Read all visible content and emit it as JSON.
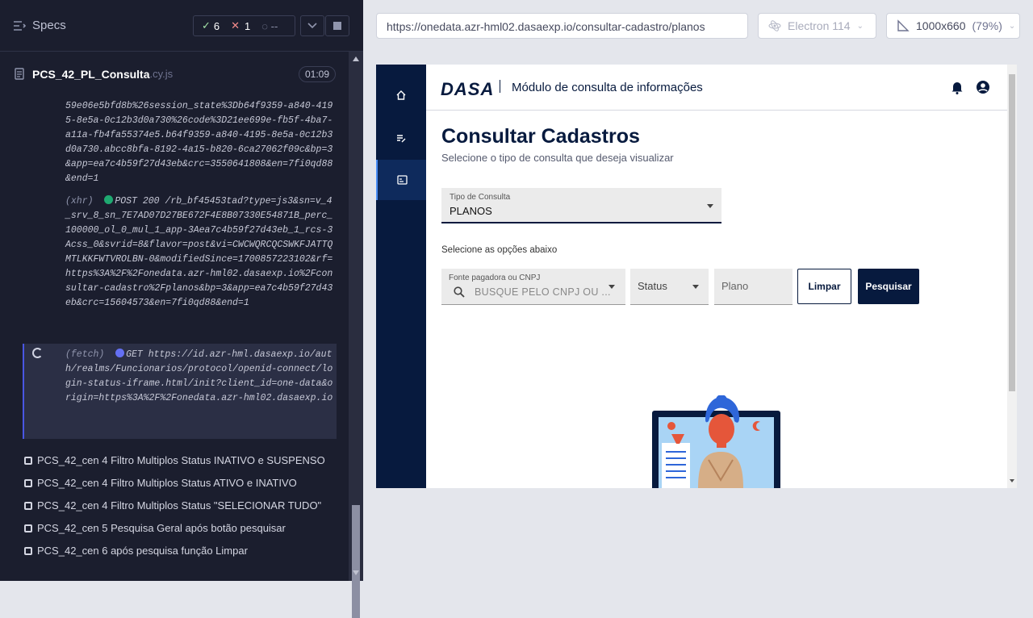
{
  "runner": {
    "specs_label": "Specs",
    "passed": "6",
    "failed": "1",
    "pending": "--",
    "spec_file": "PCS_42_PL_Consulta",
    "spec_ext": ".cy.js",
    "duration": "01:09",
    "log": {
      "entry1": "59e06e5bfd8b%26session_state%3Db64f9359-a840-4195-8e5a-0c12b3d0a730%26code%3D21ee699e-fb5f-4ba7-a11a-fb4fa55374e5.b64f9359-a840-4195-8e5a-0c12b3d0a730.abcc8bfa-8192-4a15-b820-6ca27062f09c&bp=3&app=ea7c4b59f27d43eb&crc=3550641808&en=7fi0qd88&end=1",
      "entry2_type": "(xhr)",
      "entry2_text": "POST 200 /rb_bf45453tad?type=js3&sn=v_4_srv_8_sn_7E7AD07D27BE672F4E8B07330E54871B_perc_100000_ol_0_mul_1_app-3Aea7c4b59f27d43eb_1_rcs-3Acss_0&svrid=8&flavor=post&vi=CWCWQRCQCSWKFJATTQMTLKKFWTVROLBN-0&modifiedSince=1700857223102&rf=https%3A%2F%2Fonedata.azr-hml02.dasaexp.io%2Fconsultar-cadastro%2Fplanos&bp=3&app=ea7c4b59f27d43eb&crc=15604573&en=7fi0qd88&end=1",
      "entry3_type": "(fetch)",
      "entry3_text": "GET https://id.azr-hml.dasaexp.io/auth/realms/Funcionarios/protocol/openid-connect/login-status-iframe.html/init?client_id=one-data&origin=https%3A%2F%2Fonedata.azr-hml02.dasaexp.io"
    },
    "tests": [
      "PCS_42_cen 4 Filtro Multiplos Status INATIVO e SUSPENSO",
      "PCS_42_cen 4 Filtro Multiplos Status ATIVO e INATIVO",
      "PCS_42_cen 4 Filtro Multiplos Status \"SELECIONAR TUDO\"",
      "PCS_42_cen 5 Pesquisa Geral após botão pesquisar",
      "PCS_42_cen 6 após pesquisa função Limpar"
    ]
  },
  "browser": {
    "url": "https://onedata.azr-hml02.dasaexp.io/consultar-cadastro/planos",
    "browser_name": "Electron 114",
    "viewport": "1000x660",
    "zoom": "(79%)"
  },
  "app": {
    "logo": "DASA",
    "module_title": "Módulo de consulta de informações",
    "page_title": "Consultar Cadastros",
    "page_subtitle": "Selecione o tipo de consulta que deseja visualizar",
    "tipo_label": "Tipo de Consulta",
    "tipo_value": "PLANOS",
    "options_label": "Selecione as opções abaixo",
    "fonte_label": "Fonte pagadora ou CNPJ",
    "fonte_placeholder": "BUSQUE PELO CNPJ OU ...",
    "status_label": "Status",
    "plano_label": "Plano",
    "limpar": "Limpar",
    "pesquisar": "Pesquisar"
  },
  "colors": {
    "navy": "#071a3e",
    "accent": "#4956e3"
  }
}
